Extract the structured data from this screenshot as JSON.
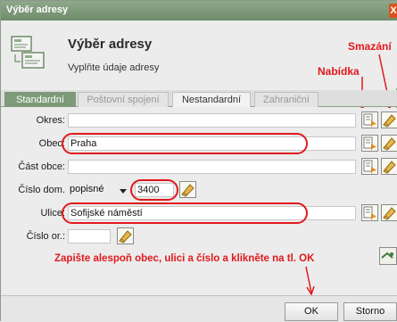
{
  "window": {
    "title": "Výběr adresy",
    "close_label": "X"
  },
  "header": {
    "title": "Výběr adresy",
    "subtitle": "Vyplňte údaje adresy"
  },
  "annotations": {
    "smazani": "Smazání",
    "nabidka": "Nabídka",
    "instruction": "Zapište alespoň obec, ulici a číslo a klikněte na tl. OK"
  },
  "tabs": [
    {
      "label": "Standardní"
    },
    {
      "label": "Poštovní spojení"
    },
    {
      "label": "Nestandardní"
    },
    {
      "label": "Zahraniční"
    }
  ],
  "form": {
    "okres": {
      "label": "Okres:",
      "value": ""
    },
    "obec": {
      "label": "Obec:",
      "value": "Praha"
    },
    "cast_obce": {
      "label": "Část obce:",
      "value": ""
    },
    "cislo_dom": {
      "label": "Číslo dom.",
      "type_value": "popisné",
      "value": "3400"
    },
    "ulice": {
      "label": "Ulice:",
      "value": "Sofijské náměstí"
    },
    "cislo_or": {
      "label": "Číslo or.:",
      "value": ""
    }
  },
  "buttons": {
    "ok": "OK",
    "storno": "Storno"
  },
  "colors": {
    "accent": "#7e9a79",
    "annotation": "#e0191e"
  }
}
